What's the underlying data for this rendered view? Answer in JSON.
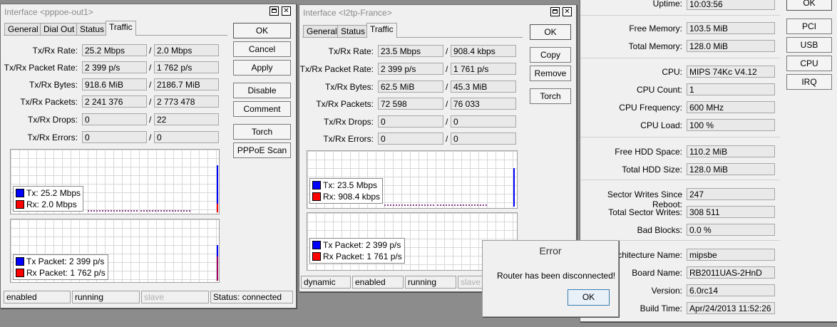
{
  "win1": {
    "title": "Interface <pppoe-out1>",
    "tabs": [
      "General",
      "Dial Out",
      "Status",
      "Traffic"
    ],
    "rows": [
      {
        "label": "Tx/Rx Rate:",
        "tx": "25.2 Mbps",
        "rx": "2.0 Mbps"
      },
      {
        "label": "Tx/Rx Packet Rate:",
        "tx": "2 399 p/s",
        "rx": "1 762 p/s"
      },
      {
        "label": "Tx/Rx Bytes:",
        "tx": "918.6 MiB",
        "rx": "2186.7 MiB"
      },
      {
        "label": "Tx/Rx Packets:",
        "tx": "2 241 376",
        "rx": "2 773 478"
      },
      {
        "label": "Tx/Rx Drops:",
        "tx": "0",
        "rx": "22"
      },
      {
        "label": "Tx/Rx Errors:",
        "tx": "0",
        "rx": "0"
      }
    ],
    "buttons": [
      "OK",
      "Cancel",
      "Apply",
      "Disable",
      "Comment",
      "Torch",
      "PPPoE Scan"
    ],
    "legend1": {
      "tx": "Tx:  25.2 Mbps",
      "rx": "Rx:  2.0 Mbps"
    },
    "legend2": {
      "tx": "Tx Packet:  2 399 p/s",
      "rx": "Rx Packet:  1 762 p/s"
    },
    "status": [
      "enabled",
      "running",
      "slave",
      "Status: connected"
    ]
  },
  "win2": {
    "title": "Interface <l2tp-France>",
    "tabs": [
      "General",
      "Status",
      "Traffic"
    ],
    "rows": [
      {
        "label": "Tx/Rx Rate:",
        "tx": "23.5 Mbps",
        "rx": "908.4 kbps"
      },
      {
        "label": "Tx/Rx Packet Rate:",
        "tx": "2 399 p/s",
        "rx": "1 761 p/s"
      },
      {
        "label": "Tx/Rx Bytes:",
        "tx": "62.5 MiB",
        "rx": "45.3 MiB"
      },
      {
        "label": "Tx/Rx Packets:",
        "tx": "72 598",
        "rx": "76 033"
      },
      {
        "label": "Tx/Rx Drops:",
        "tx": "0",
        "rx": "0"
      },
      {
        "label": "Tx/Rx Errors:",
        "tx": "0",
        "rx": "0"
      }
    ],
    "buttons": [
      "OK",
      "Copy",
      "Remove",
      "Torch"
    ],
    "legend1": {
      "tx": "Tx:  23.5 Mbps",
      "rx": "Rx:  908.4 kbps"
    },
    "legend2": {
      "tx": "Tx Packet:  2 399 p/s",
      "rx": "Rx Packet:  1 761 p/s"
    },
    "status": [
      "dynamic",
      "enabled",
      "running",
      "slave"
    ]
  },
  "resources": {
    "rows": [
      {
        "label": "Uptime:",
        "value": "10:03:56"
      },
      {
        "label": "Free Memory:",
        "value": "103.5 MiB"
      },
      {
        "label": "Total Memory:",
        "value": "128.0 MiB"
      },
      {
        "label": "CPU:",
        "value": "MIPS 74Kc V4.12"
      },
      {
        "label": "CPU Count:",
        "value": "1"
      },
      {
        "label": "CPU Frequency:",
        "value": "600 MHz"
      },
      {
        "label": "CPU Load:",
        "value": "100 %"
      },
      {
        "label": "Free HDD Space:",
        "value": "110.2 MiB"
      },
      {
        "label": "Total HDD Size:",
        "value": "128.0 MiB"
      },
      {
        "label": "Sector Writes Since Reboot:",
        "value": "247"
      },
      {
        "label": "Total Sector Writes:",
        "value": "308 511"
      },
      {
        "label": "Bad Blocks:",
        "value": "0.0 %"
      },
      {
        "label": "Architecture Name:",
        "value": "mipsbe"
      },
      {
        "label": "Board Name:",
        "value": "RB2011UAS-2HnD"
      },
      {
        "label": "Version:",
        "value": "6.0rc14"
      },
      {
        "label": "Build Time:",
        "value": "Apr/24/2013 11:52:26"
      }
    ],
    "buttons": [
      "OK",
      "PCI",
      "USB",
      "CPU",
      "IRQ"
    ]
  },
  "error": {
    "title": "Error",
    "message": "Router has been disconnected!",
    "ok": "OK"
  },
  "colors": {
    "tx": "#0000ff",
    "rx": "#ff0000"
  }
}
